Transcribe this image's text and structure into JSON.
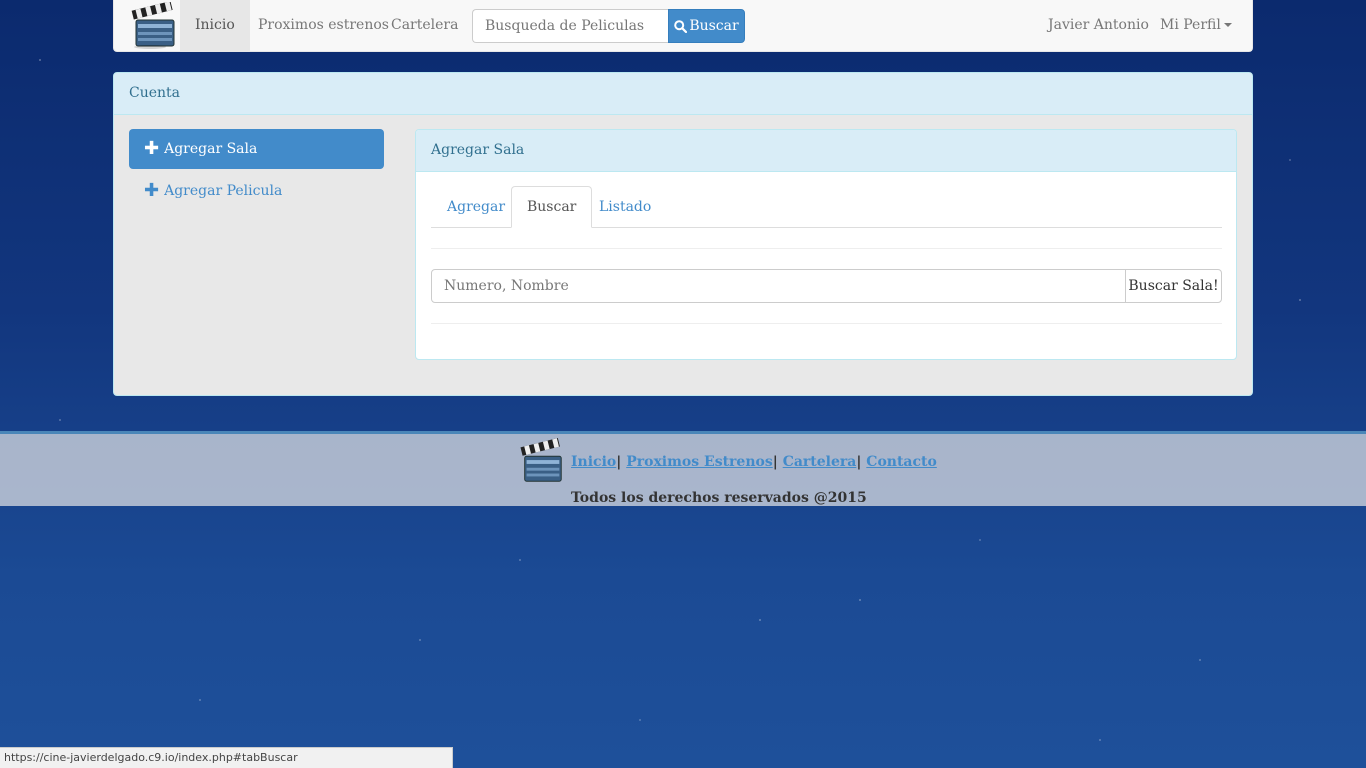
{
  "navbar": {
    "items": [
      {
        "label": "Inicio",
        "active": true
      },
      {
        "label": "Proximos estrenos"
      },
      {
        "label": "Cartelera"
      }
    ],
    "search": {
      "placeholder": "Busqueda de Peliculas",
      "button_label": "Buscar",
      "button_icon": "search-icon"
    },
    "user_name": "Javier Antonio",
    "profile_label": "Mi Perfil"
  },
  "account": {
    "heading": "Cuenta",
    "sidebar": [
      {
        "label": "Agregar Sala",
        "icon": "plus-icon",
        "active": true
      },
      {
        "label": "Agregar Pelicula",
        "icon": "plus-icon"
      }
    ],
    "panel": {
      "heading": "Agregar Sala",
      "tabs": [
        {
          "label": "Agregar"
        },
        {
          "label": "Buscar",
          "active": true
        },
        {
          "label": "Listado"
        }
      ],
      "search_placeholder": "Numero, Nombre",
      "search_button": "Buscar Sala!"
    }
  },
  "footer": {
    "links": [
      "Inicio",
      "Proximos Estrenos",
      "Cartelera",
      "Contacto"
    ],
    "separator": "|",
    "copyright": "Todos los derechos reservados @2015"
  },
  "statusbar": {
    "url": "https://cine-javierdelgado.c9.io/index.php#tabBuscar"
  },
  "colors": {
    "primary": "#428bca",
    "panel_heading": "#d9edf7",
    "panel_text": "#31708f"
  }
}
